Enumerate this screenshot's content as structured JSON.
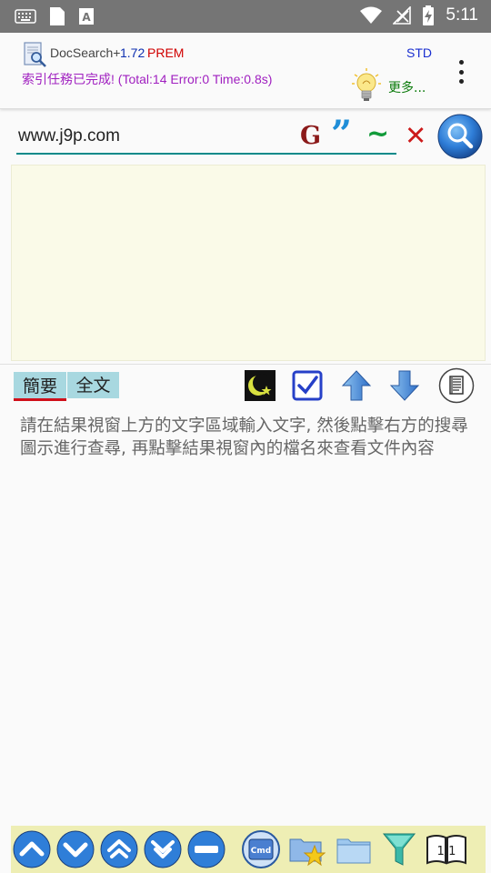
{
  "status_bar": {
    "time": "5:11",
    "icons": [
      "keyboard-icon",
      "sim-card-icon",
      "font-a-icon",
      "wifi-icon",
      "no-signal-icon",
      "battery-charging-icon"
    ]
  },
  "header": {
    "app_name": "DocSearch+",
    "version": "1.72",
    "edition": "PREM",
    "std_label": "STD",
    "status_message": "索引任務已完成! (Total:14 Error:0 Time:0.8s)",
    "more_label": "更多..."
  },
  "search": {
    "value": "www.j9p.com",
    "google_label": "G",
    "quote_label": "”",
    "tilde_label": "~",
    "clear_label": "✕"
  },
  "tabs": {
    "summary": "簡要",
    "full_text": "全文"
  },
  "hint_text": "請在結果視窗上方的文字區域輸入文字, 然後點擊右方的搜尋圖示進行查尋, 再點擊結果視窗內的檔名來查看文件內容",
  "bottom_bar": {
    "cmd_label": "Cmd",
    "page_label": "1/1"
  },
  "colors": {
    "status_bar": "#757575",
    "result_bg": "#fafae8",
    "bottom_bar_bg": "#eeeeb4",
    "accent_teal": "#0b8a8a",
    "tab_bg": "#a8d8e0"
  }
}
